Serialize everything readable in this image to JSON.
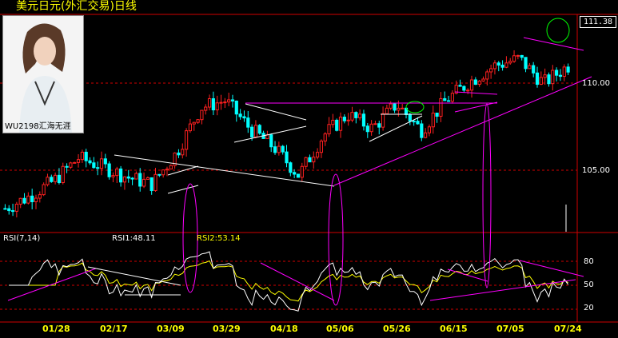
{
  "title": "美元日元(外汇交易)日线",
  "photo": {
    "caption": "WU2198汇海无涯"
  },
  "price_box": "111.38",
  "y_labels": [
    "110.00",
    "105.00"
  ],
  "rsi": {
    "label": "RSI(7,14)",
    "rsi1": "RSI1:48.11",
    "rsi2": "RSI2:53.14",
    "levels": [
      "80",
      "50",
      "20"
    ]
  },
  "x_labels": [
    "01/28",
    "02/17",
    "03/09",
    "03/29",
    "04/18",
    "05/06",
    "05/26",
    "06/15",
    "07/05",
    "07/24"
  ],
  "colors": {
    "up": "#ff2020",
    "down": "#00ffff",
    "rsi1": "#ffffff",
    "rsi2": "#ffff00",
    "trend": "#ff00ff",
    "grid": "#d00000"
  },
  "chart_data": {
    "type": "candlestick",
    "title": "美元日元(外汇交易)日线",
    "x": [
      "01/28",
      "02/17",
      "03/09",
      "03/29",
      "04/18",
      "05/06",
      "05/26",
      "06/15",
      "07/05",
      "07/24"
    ],
    "y_ticks": [
      105.0,
      110.0
    ],
    "ylim": [
      101.5,
      112.0
    ],
    "close_path": [
      [
        0,
        102.8
      ],
      [
        1,
        103.5
      ],
      [
        2,
        104.4
      ],
      [
        3,
        105.7
      ],
      [
        4,
        105.2
      ],
      [
        5,
        104.6
      ],
      [
        6,
        104.2
      ],
      [
        7,
        106.0
      ],
      [
        8,
        108.6
      ],
      [
        9,
        109.0
      ],
      [
        10,
        107.4
      ],
      [
        11,
        106.3
      ],
      [
        12,
        104.7
      ],
      [
        13,
        107.0
      ],
      [
        14,
        108.2
      ],
      [
        15,
        107.4
      ],
      [
        16,
        108.8
      ],
      [
        17,
        107.3
      ],
      [
        18,
        109.0
      ],
      [
        19,
        110.1
      ],
      [
        20,
        111.0
      ],
      [
        21,
        111.4
      ],
      [
        22,
        110.0
      ],
      [
        23,
        111.0
      ]
    ],
    "close_path_x_unit": "approximate position along the date axis, 0-23",
    "rsi": {
      "levels": [
        80,
        50,
        20
      ],
      "rsi1_last": 48.11,
      "rsi2_last": 53.14
    }
  }
}
